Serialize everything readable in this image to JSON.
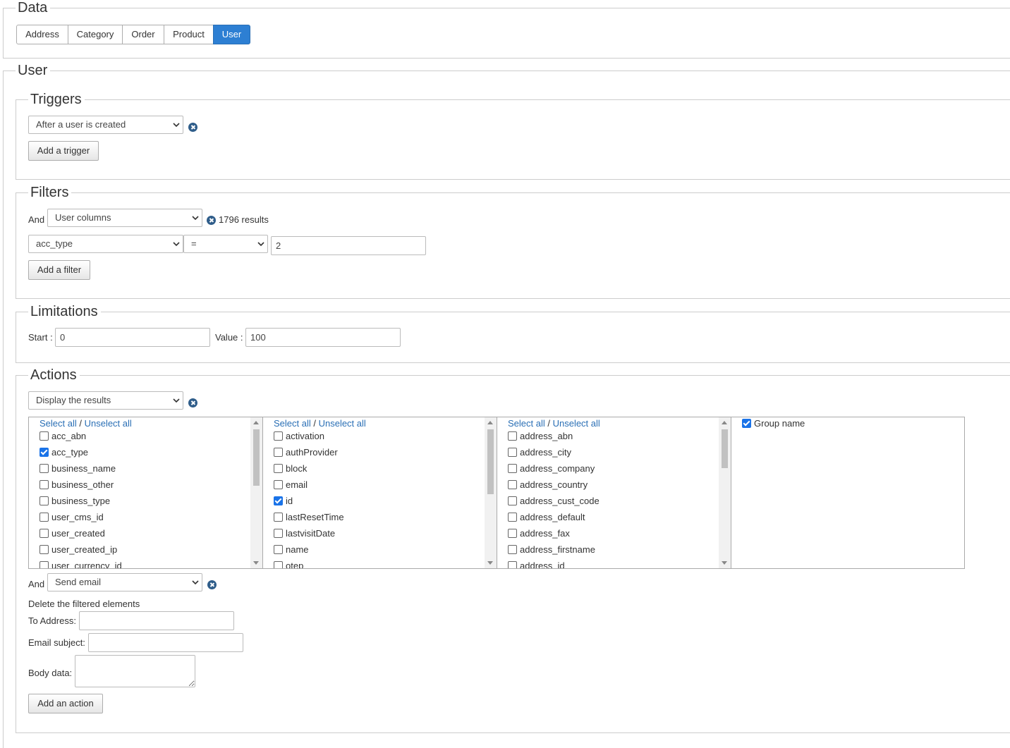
{
  "data_section": {
    "legend": "Data",
    "tabs": [
      {
        "label": "Address"
      },
      {
        "label": "Category"
      },
      {
        "label": "Order"
      },
      {
        "label": "Product"
      },
      {
        "label": "User"
      }
    ],
    "active_tab": "User"
  },
  "user_section": {
    "legend": "User",
    "triggers": {
      "legend": "Triggers",
      "selected": "After a user is created",
      "add_label": "Add a trigger"
    },
    "filters": {
      "legend": "Filters",
      "and_label": "And",
      "type_selected": "User columns",
      "results_text": "1796 results",
      "column_selected": "acc_type",
      "operator_selected": "=",
      "value": "2",
      "add_label": "Add a filter"
    },
    "limitations": {
      "legend": "Limitations",
      "start_label": "Start :",
      "start_value": "0",
      "value_label": "Value :",
      "value_value": "100"
    },
    "actions": {
      "legend": "Actions",
      "display_selected": "Display the results",
      "select_all": "Select all",
      "separator": " / ",
      "unselect_all": "Unselect all",
      "columns": [
        {
          "items": [
            {
              "label": "acc_abn",
              "checked": false
            },
            {
              "label": "acc_type",
              "checked": true
            },
            {
              "label": "business_name",
              "checked": false
            },
            {
              "label": "business_other",
              "checked": false
            },
            {
              "label": "business_type",
              "checked": false
            },
            {
              "label": "user_cms_id",
              "checked": false
            },
            {
              "label": "user_created",
              "checked": false
            },
            {
              "label": "user_created_ip",
              "checked": false
            },
            {
              "label": "user_currency_id",
              "checked": false
            }
          ]
        },
        {
          "items": [
            {
              "label": "activation",
              "checked": false
            },
            {
              "label": "authProvider",
              "checked": false
            },
            {
              "label": "block",
              "checked": false
            },
            {
              "label": "email",
              "checked": false
            },
            {
              "label": "id",
              "checked": true
            },
            {
              "label": "lastResetTime",
              "checked": false
            },
            {
              "label": "lastvisitDate",
              "checked": false
            },
            {
              "label": "name",
              "checked": false
            },
            {
              "label": "otep",
              "checked": false
            }
          ]
        },
        {
          "items": [
            {
              "label": "address_abn",
              "checked": false
            },
            {
              "label": "address_city",
              "checked": false
            },
            {
              "label": "address_company",
              "checked": false
            },
            {
              "label": "address_country",
              "checked": false
            },
            {
              "label": "address_cust_code",
              "checked": false
            },
            {
              "label": "address_default",
              "checked": false
            },
            {
              "label": "address_fax",
              "checked": false
            },
            {
              "label": "address_firstname",
              "checked": false
            },
            {
              "label": "address_id",
              "checked": false
            }
          ]
        }
      ],
      "group_name": {
        "label": "Group name",
        "checked": true
      },
      "and_label": "And",
      "email_selected": "Send email",
      "delete_text": "Delete the filtered elements",
      "to_address_label": "To Address:",
      "email_subject_label": "Email subject:",
      "body_data_label": "Body data:",
      "add_label": "Add an action"
    }
  },
  "colors": {
    "accent": "#2d7fd3",
    "link": "#2a6fb5",
    "remove_icon": "#2f5d8a"
  }
}
